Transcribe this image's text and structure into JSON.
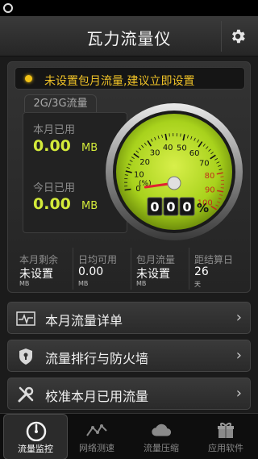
{
  "app": {
    "title": "瓦力流量仪"
  },
  "colors": {
    "accent": "#d3ea3a",
    "warning": "#f0c227",
    "needle": "#e23",
    "gaugeFace": "#b9df25"
  },
  "notice": {
    "text": "未设置包月流量,建议立即设置"
  },
  "tab": {
    "label": "2G/3G流量"
  },
  "usage": {
    "month_label": "本月已用",
    "month_value": "0.00",
    "month_unit": "MB",
    "today_label": "今日已用",
    "today_value": "0.00",
    "today_unit": "MB"
  },
  "gauge": {
    "ticks": [
      "0",
      "10",
      "20",
      "30",
      "40",
      "50",
      "60",
      "70",
      "80",
      "90",
      "100"
    ],
    "percent_label": "(%)",
    "digits": [
      "0",
      "0",
      "0"
    ],
    "percent_sign": "%",
    "value": 0
  },
  "stats": [
    {
      "label": "本月剩余",
      "value": "未设置",
      "unit": "MB"
    },
    {
      "label": "日均可用",
      "value": "0.00",
      "unit": "MB"
    },
    {
      "label": "包月流量",
      "value": "未设置",
      "unit": "MB"
    },
    {
      "label": "距结算日",
      "value": "26",
      "unit": "天"
    }
  ],
  "menu": [
    {
      "label": "本月流量详单",
      "icon": "chart-icon"
    },
    {
      "label": "流量排行与防火墙",
      "icon": "shield-icon"
    },
    {
      "label": "校准本月已用流量",
      "icon": "tools-icon"
    }
  ],
  "tabs": [
    {
      "label": "流量监控",
      "icon": "speedometer-icon",
      "active": true
    },
    {
      "label": "网络测速",
      "icon": "speedtest-icon",
      "active": false
    },
    {
      "label": "流量压缩",
      "icon": "cloud-icon",
      "active": false
    },
    {
      "label": "应用软件",
      "icon": "gift-box-icon",
      "active": false
    }
  ]
}
